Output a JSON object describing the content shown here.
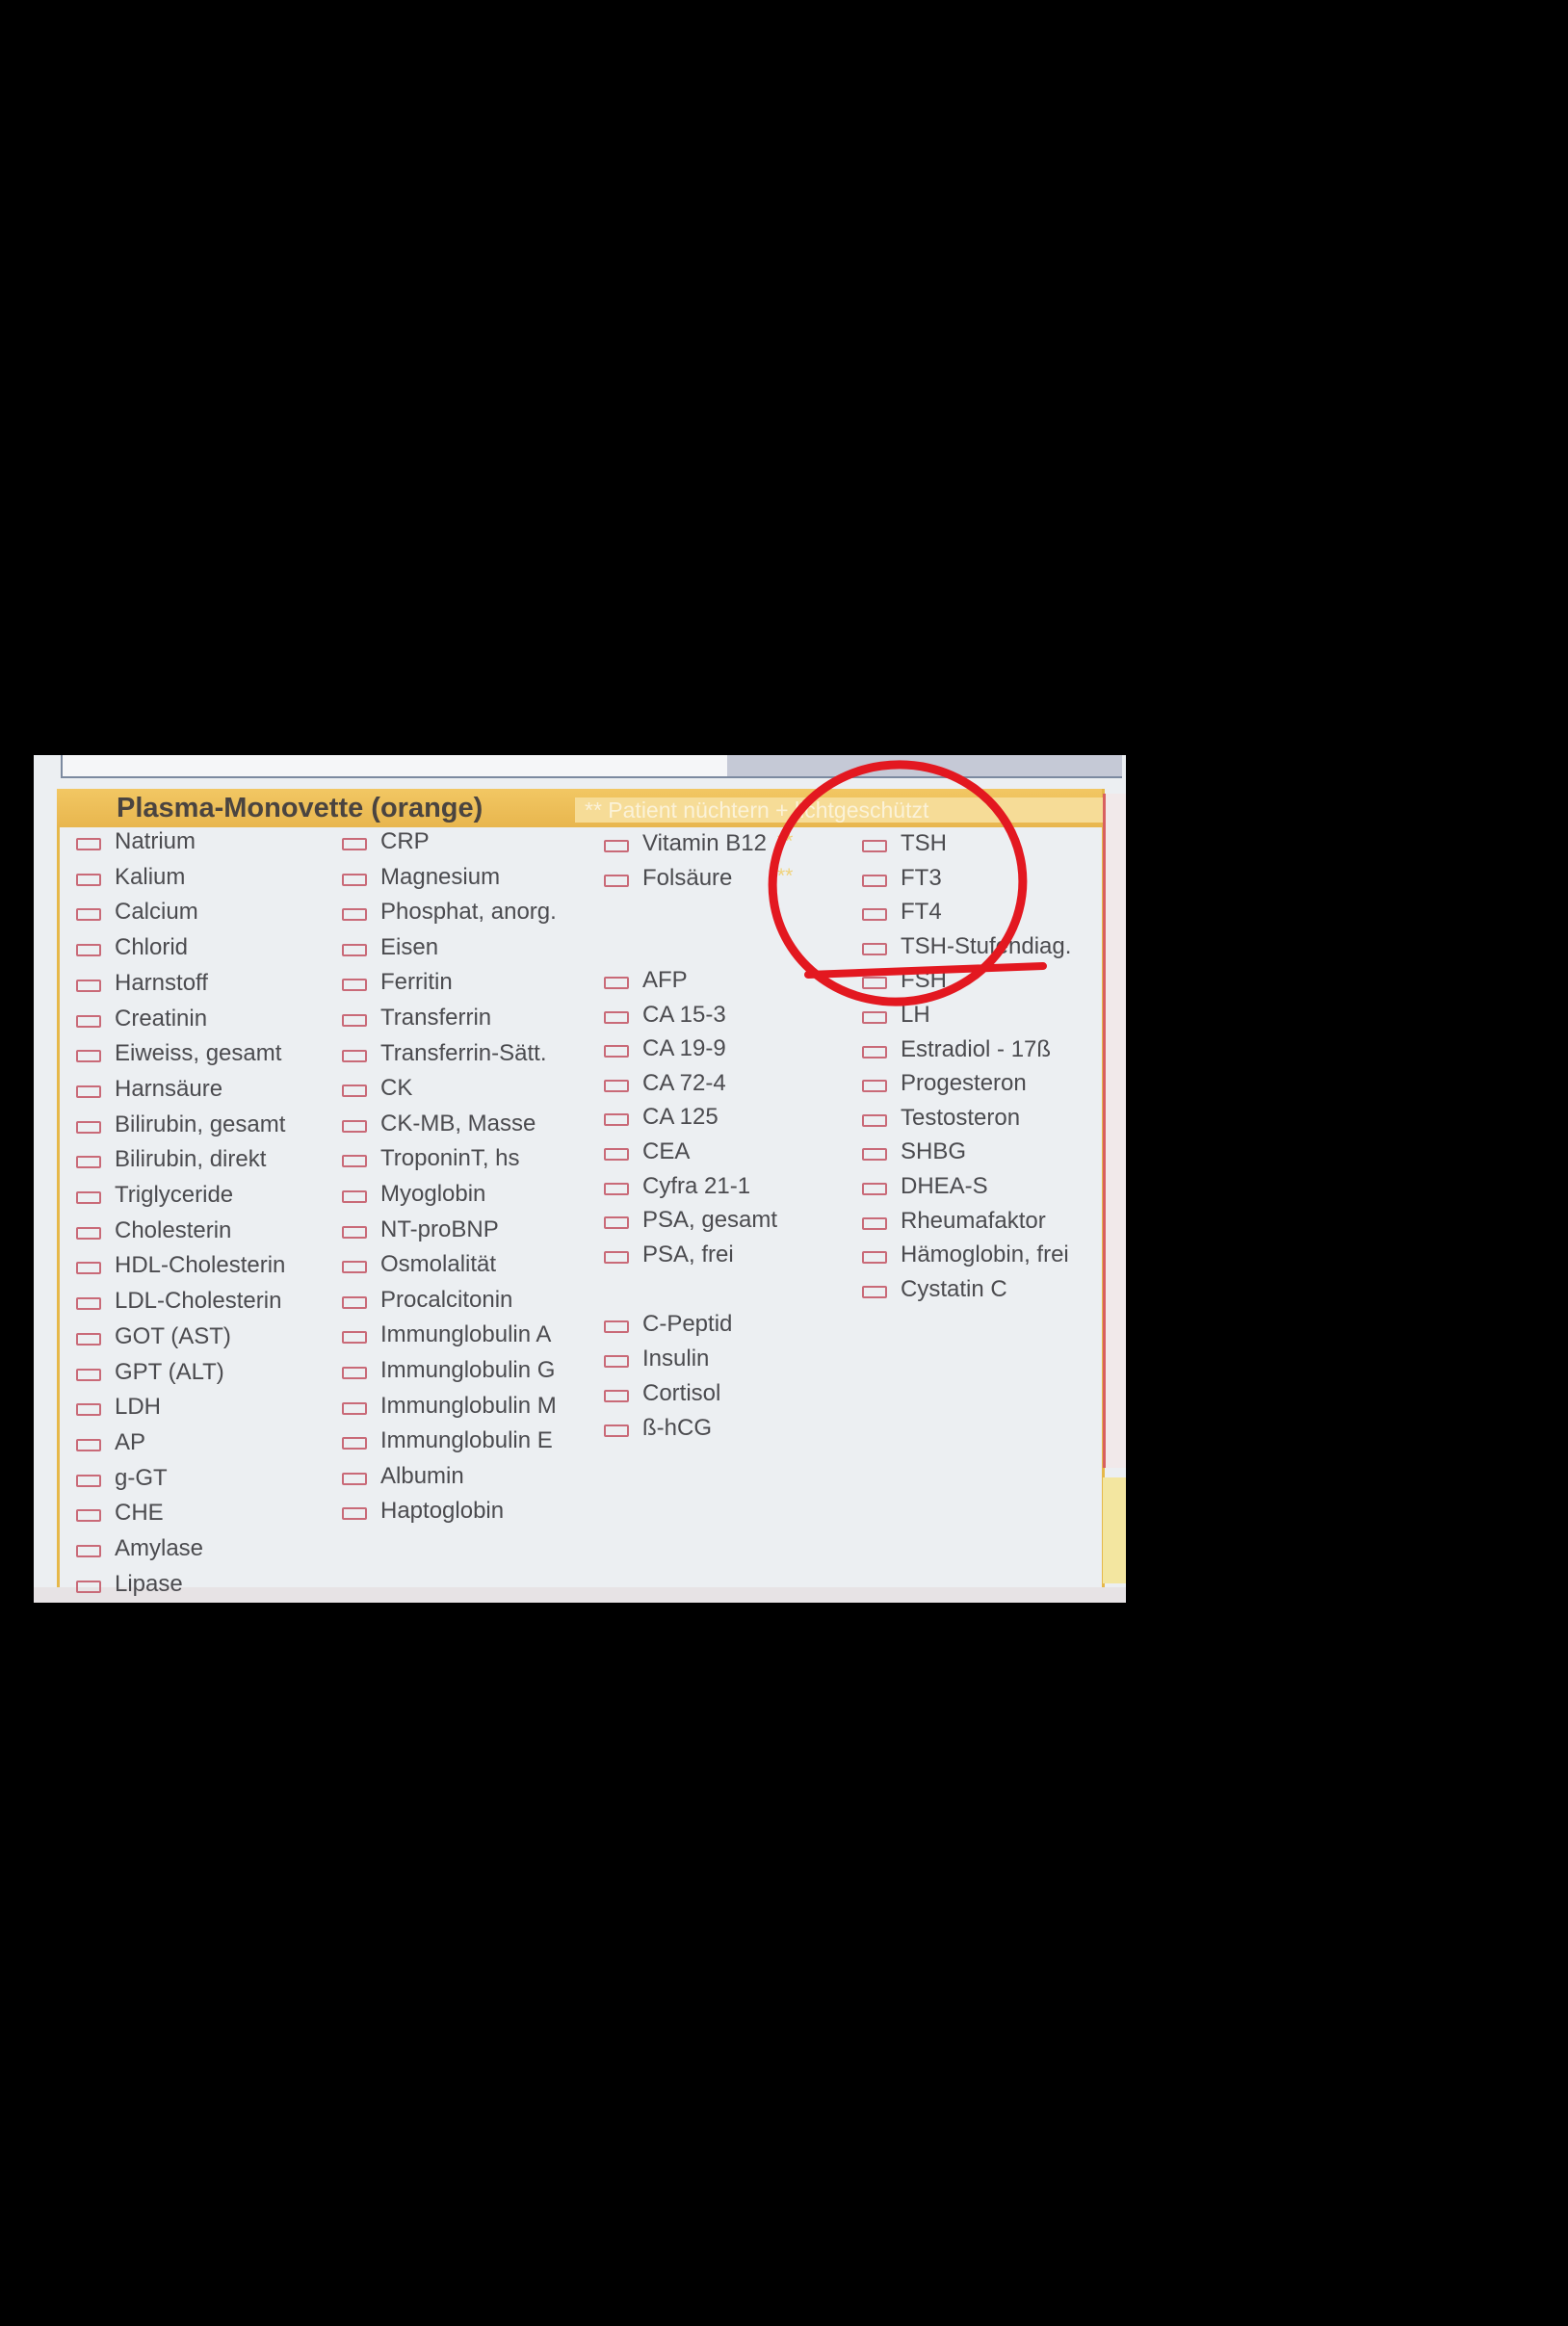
{
  "header": {
    "title": "Plasma-Monovette (orange)",
    "note": "** Patient nüchtern + lichtgeschützt"
  },
  "columns": [
    {
      "tests": [
        "Natrium",
        "Kalium",
        "Calcium",
        "Chlorid",
        "Harnstoff",
        "Creatinin",
        "Eiweiss, gesamt",
        "Harnsäure",
        "Bilirubin, gesamt",
        "Bilirubin, direkt",
        "Triglyceride",
        "Cholesterin",
        "HDL-Cholesterin",
        "LDL-Cholesterin",
        "GOT (AST)",
        "GPT (ALT)",
        "LDH",
        "AP",
        "g-GT",
        "CHE",
        "Amylase",
        "Lipase"
      ]
    },
    {
      "tests": [
        "CRP",
        "Magnesium",
        "Phosphat, anorg.",
        "Eisen",
        "Ferritin",
        "Transferrin",
        "Transferrin-Sätt.",
        "CK",
        "CK-MB, Masse",
        "TroponinT, hs",
        "Myoglobin",
        "NT-proBNP",
        "Osmolalität",
        "Procalcitonin",
        "Immunglobulin  A",
        "Immunglobulin G",
        "Immunglobulin M",
        "Immunglobulin E",
        "Albumin",
        "Haptoglobin"
      ]
    },
    {
      "group1": [
        "Vitamin B12",
        "Folsäure"
      ],
      "stars": "**",
      "group2": [
        "AFP",
        "CA 15-3",
        "CA 19-9",
        "CA 72-4",
        "CA 125",
        "CEA",
        "Cyfra 21-1",
        "PSA, gesamt",
        "PSA, frei"
      ],
      "group3": [
        "C-Peptid",
        "Insulin",
        "Cortisol",
        "ß-hCG"
      ]
    },
    {
      "tests": [
        "TSH",
        "FT3",
        "FT4",
        "TSH-Stufendiag.",
        "FSH",
        "LH",
        "Estradiol - 17ß",
        "Progesteron",
        "Testosteron",
        "SHBG",
        "DHEA-S",
        "Rheumafaktor",
        "Hämoglobin, frei",
        "Cystatin C"
      ]
    }
  ],
  "annotation": {
    "color": "#e31820",
    "circled_tests": [
      "TSH",
      "FT3",
      "FT4",
      "TSH-Stufendiag."
    ],
    "struck_test": "FSH"
  }
}
